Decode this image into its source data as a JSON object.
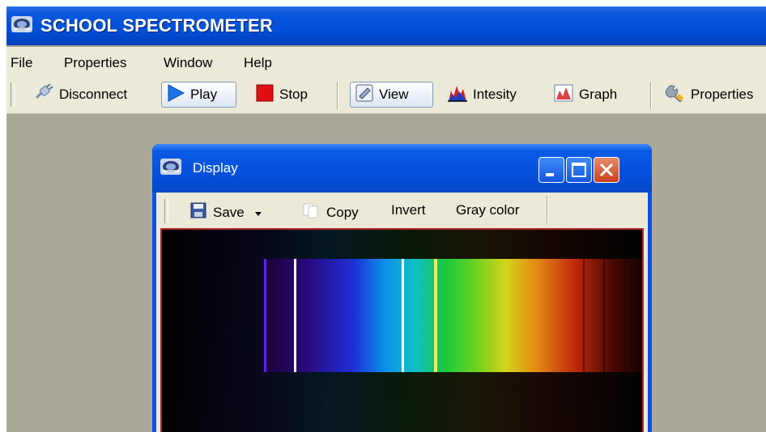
{
  "app": {
    "title": "SCHOOL SPECTROMETER"
  },
  "menu": {
    "items": [
      "File",
      "Properties",
      "Window",
      "Help"
    ]
  },
  "toolbar": {
    "disconnect_label": "Disconnect",
    "play_label": "Play",
    "stop_label": "Stop",
    "view_label": "View",
    "intensity_label": "Intesity",
    "graph_label": "Graph",
    "properties_label": "Properties"
  },
  "display_window": {
    "title": "Display",
    "toolbar": {
      "save_label": "Save",
      "copy_label": "Copy",
      "invert_label": "Invert",
      "gray_label": "Gray color"
    }
  },
  "icons": {
    "app": "spectrometer-logo-icon",
    "disconnect": "plug-icon",
    "play": "play-triangle-icon",
    "stop": "stop-square-icon",
    "view": "view-icon",
    "intensity": "intensity-peaks-icon",
    "graph": "graph-icon",
    "properties": "wrench-icon",
    "save": "floppy-disk-icon",
    "copy": "copy-pages-icon"
  },
  "colors": {
    "titlebar": "#0050D8",
    "workspace": "#ACA899",
    "stop_red": "#E01010",
    "play_blue": "#1E74E8",
    "close_red": "#D2552C"
  }
}
